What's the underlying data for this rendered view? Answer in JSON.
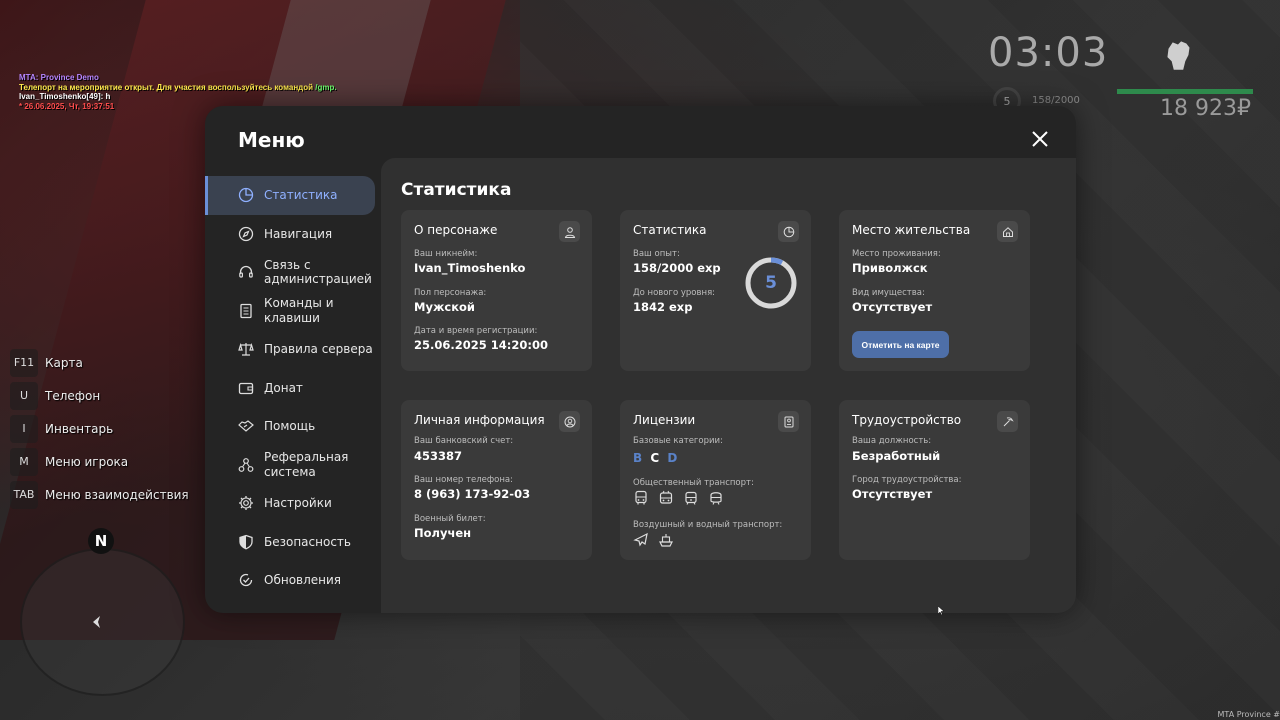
{
  "chat": {
    "line1": "MTA: Province Demo",
    "line2_a": "Телепорт на мероприятие открыт. Для участия воспользуйтесь командой ",
    "line2_cmd": "/gmp.",
    "line3": "Ivan_Timoshenko[49]: h",
    "line4": "* 26.06.2025, Чт, 19:37:51"
  },
  "hud": {
    "time": "03:03",
    "level": "5",
    "exp": "158/2000",
    "money": "18 923₽",
    "fist_icon": "fist-icon"
  },
  "keybinds": [
    {
      "key": "F11",
      "label": "Карта"
    },
    {
      "key": "U",
      "label": "Телефон"
    },
    {
      "key": "I",
      "label": "Инвентарь"
    },
    {
      "key": "M",
      "label": "Меню игрока"
    },
    {
      "key": "TAB",
      "label": "Меню взаимодействия"
    }
  ],
  "minimap": {
    "north": "N"
  },
  "watermark": "MTA Province #",
  "menu": {
    "title": "Меню",
    "nav": [
      {
        "label": "Статистика",
        "icon": "chart-pie-icon"
      },
      {
        "label": "Навигация",
        "icon": "compass-icon"
      },
      {
        "label": "Связь с администрацией",
        "icon": "headset-icon"
      },
      {
        "label": "Команды и клавиши",
        "icon": "document-icon"
      },
      {
        "label": "Правила сервера",
        "icon": "scales-icon"
      },
      {
        "label": "Донат",
        "icon": "wallet-icon"
      },
      {
        "label": "Помощь",
        "icon": "handshake-icon"
      },
      {
        "label": "Реферальная система",
        "icon": "referral-icon"
      },
      {
        "label": "Настройки",
        "icon": "gear-icon"
      },
      {
        "label": "Безопасность",
        "icon": "shield-icon"
      },
      {
        "label": "Обновления",
        "icon": "update-icon"
      }
    ],
    "content_title": "Статистика",
    "character": {
      "title": "О персонаже",
      "nick_label": "Ваш никнейм:",
      "nick": "Ivan_Timoshenko",
      "gender_label": "Пол персонажа:",
      "gender": "Мужской",
      "reg_label": "Дата и время регистрации:",
      "reg": "25.06.2025 14:20:00"
    },
    "stats": {
      "title": "Статистика",
      "exp_label": "Ваш опыт:",
      "exp": "158/2000 exp",
      "next_label": "До нового уровня:",
      "next": "1842 exp",
      "level": "5",
      "progress": 0.079
    },
    "residence": {
      "title": "Место жительства",
      "place_label": "Место проживания:",
      "place": "Приволжск",
      "property_label": "Вид имущества:",
      "property": "Отсутствует",
      "button": "Отметить на карте"
    },
    "personal": {
      "title": "Личная информация",
      "bank_label": "Ваш банковский счет:",
      "bank": "453387",
      "phone_label": "Ваш номер телефона:",
      "phone": "8 (963) 173-92-03",
      "military_label": "Военный билет:",
      "military": "Получен"
    },
    "licenses": {
      "title": "Лицензии",
      "base_label": "Базовые категории:",
      "cat_b": "B",
      "cat_c": "C",
      "cat_d": "D",
      "public_label": "Общественный транспорт:",
      "air_label": "Воздушный и водный транспорт:"
    },
    "employment": {
      "title": "Трудоустройство",
      "position_label": "Ваша должность:",
      "position": "Безработный",
      "city_label": "Город трудоустройства:",
      "city": "Отсутствует"
    }
  },
  "colors": {
    "accent": "#6a8fd8",
    "button": "#4e6fa8",
    "panel": "#242424",
    "card": "#3a3a3a"
  }
}
